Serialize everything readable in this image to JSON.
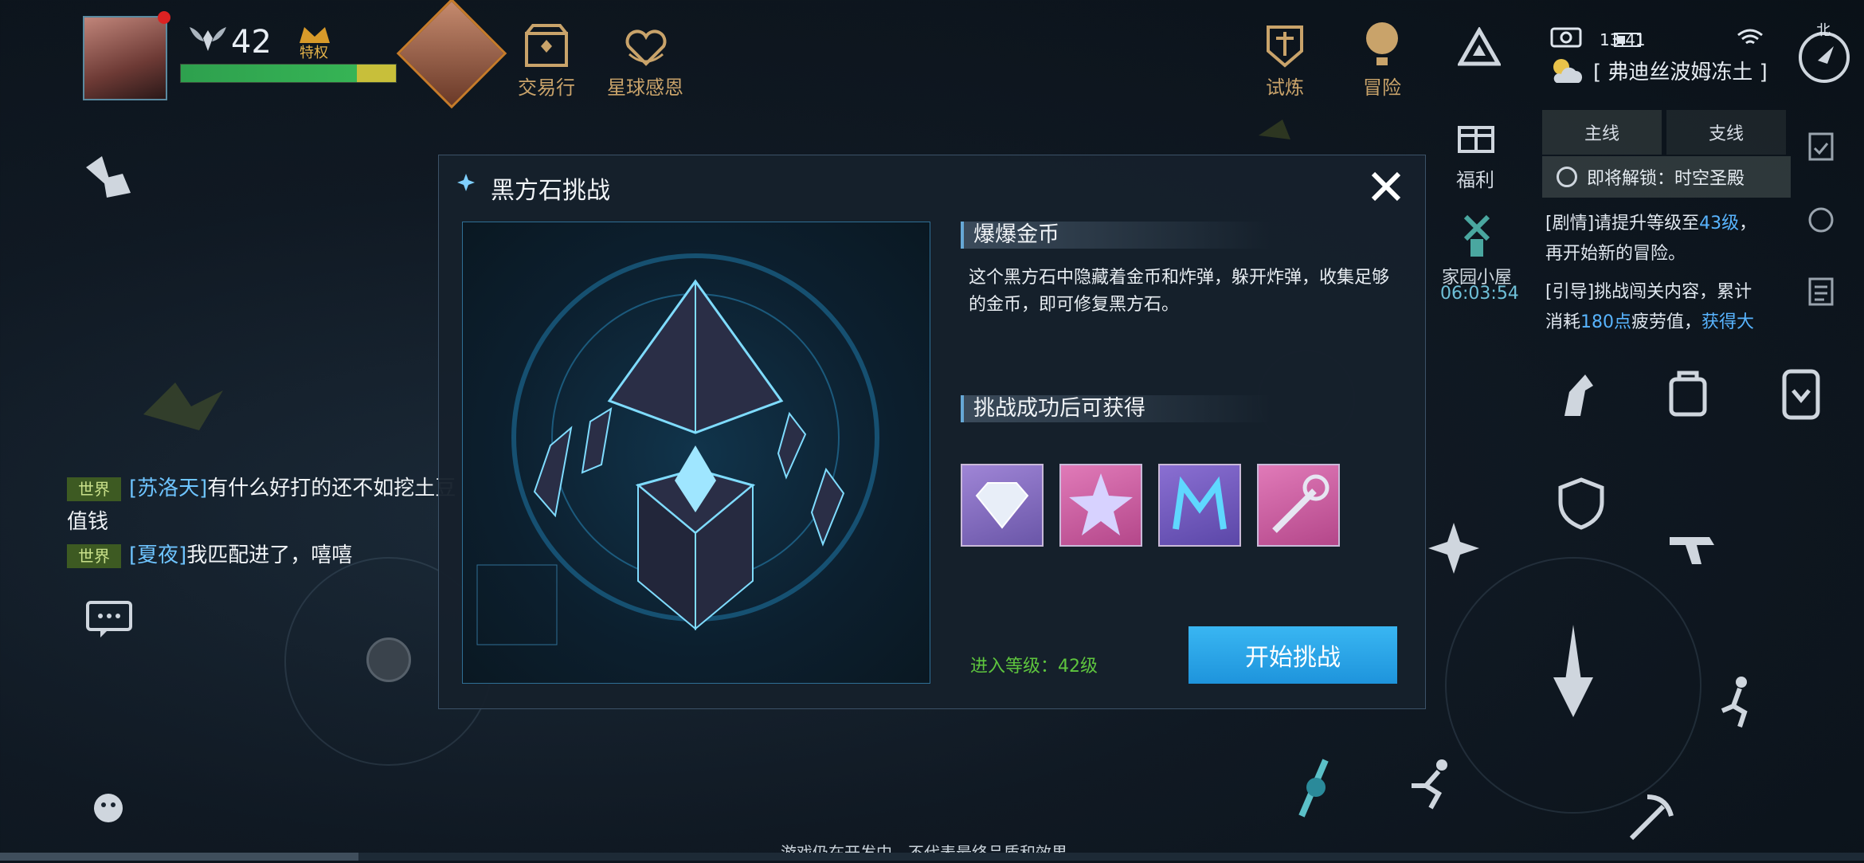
{
  "top_bar": {
    "player_level": "42",
    "privilege_label": "特权",
    "hp_percent": 82,
    "mp_percent": 18,
    "trade_label": "交易行",
    "planet_label": "星球感恩",
    "trial_label": "试炼",
    "adventure_label": "冒险"
  },
  "status": {
    "time": "13:41",
    "compass_label": "北",
    "location": "[ 弗迪丝波姆冻土 ]"
  },
  "quest_panel": {
    "tabs": [
      "主线",
      "支线"
    ],
    "unlock_text": "即将解锁：时空圣殿",
    "welfare_label": "福利",
    "home_label": "家园小屋",
    "home_timer": "06:03:54",
    "lines": [
      {
        "pre": "[剧情]请提升等级至",
        "hl": "43级",
        "post": "，"
      },
      {
        "pre": "再开始新的冒险。",
        "hl": "",
        "post": ""
      },
      {
        "pre": "[引导]挑战闯关内容，累计",
        "hl": "",
        "post": ""
      },
      {
        "pre": "消耗",
        "hl": "180点",
        "post": "疲劳值，",
        "hl2": "获得大"
      }
    ]
  },
  "chat": [
    {
      "channel": "世界",
      "name": "[苏洛天]",
      "text": "有什么好打的还不如挖土豆"
    },
    {
      "channel": "",
      "name": "",
      "text": "值钱"
    },
    {
      "channel": "世界",
      "name": "[夏夜]",
      "text": "我匹配进了，嘻嘻"
    }
  ],
  "dialog": {
    "title": "黑方石挑战",
    "section1_title": "爆爆金币",
    "description": "这个黑方石中隐藏着金币和炸弹，躲开炸弹，收集足够的金币，即可修复黑方石。",
    "section2_title": "挑战成功后可获得",
    "rewards": [
      "diamond-icon",
      "star-crystal-icon",
      "crown-emblem-icon",
      "scepter-icon"
    ],
    "entry_level": "进入等级：42级",
    "start_button": "开始挑战"
  },
  "footer": {
    "dev_note": "游戏仍在开发中，不代表最终品质和效果"
  },
  "colors": {
    "accent_blue": "#39b6f2",
    "gold": "#c9a36a",
    "green": "#5ec53e",
    "highlight": "#58b4ff"
  }
}
